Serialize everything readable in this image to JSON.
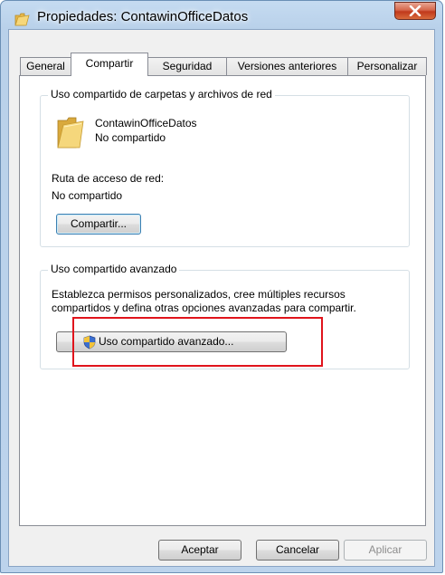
{
  "window": {
    "title": "Propiedades: ContawinOfficeDatos",
    "close_symbol": "X"
  },
  "tabs": [
    {
      "label": "General",
      "active": false
    },
    {
      "label": "Compartir",
      "active": true
    },
    {
      "label": "Seguridad",
      "active": false
    },
    {
      "label": "Versiones anteriores",
      "active": false
    },
    {
      "label": "Personalizar",
      "active": false
    }
  ],
  "network_sharing": {
    "title": "Uso compartido de carpetas y archivos de red",
    "folder_name": "ContawinOfficeDatos",
    "folder_status": "No compartido",
    "path_label": "Ruta de acceso de red:",
    "path_value": "No compartido",
    "share_button": "Compartir..."
  },
  "advanced_sharing": {
    "title": "Uso compartido avanzado",
    "description_line1": "Establezca permisos personalizados, cree múltiples recursos",
    "description_line2": "compartidos y defina otras opciones avanzadas para compartir.",
    "button": "Uso compartido avanzado..."
  },
  "footer": {
    "ok": "Aceptar",
    "cancel": "Cancelar",
    "apply": "Aplicar"
  },
  "colors": {
    "highlight": "#e0141c",
    "title_bar": "#bcd3ec",
    "folder": "#f3d36b"
  }
}
